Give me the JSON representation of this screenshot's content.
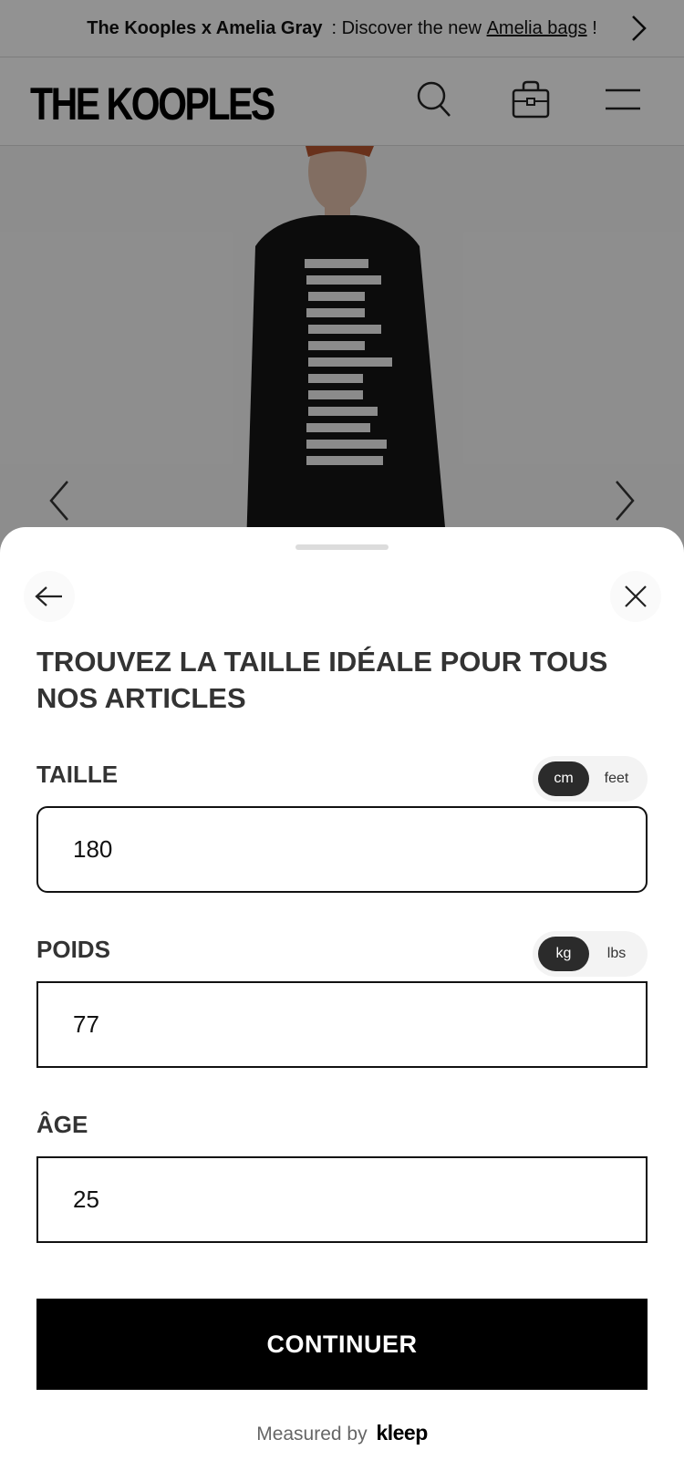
{
  "promo": {
    "collab": "The Kooples x Amelia Gray",
    "text_before": ": Discover the new",
    "link": "Amelia bags",
    "text_after": "!"
  },
  "header": {
    "logo": "THE KOOPLES",
    "icons": [
      "search-icon",
      "bag-icon",
      "menu-icon"
    ]
  },
  "sheet": {
    "title": "TROUVEZ LA TAILLE IDÉALE POUR TOUS NOS ARTICLES",
    "height": {
      "label": "TAILLE",
      "units": [
        "cm",
        "feet"
      ],
      "selected_unit": "cm",
      "value": "180"
    },
    "weight": {
      "label": "POIDS",
      "units": [
        "kg",
        "lbs"
      ],
      "selected_unit": "kg",
      "value": "77"
    },
    "age": {
      "label": "ÂGE",
      "value": "25"
    },
    "continue_label": "CONTINUER",
    "measured_by": "Measured by",
    "measured_brand": "kleep"
  },
  "colors": {
    "overlay": "#00000066",
    "primary_button": "#000000",
    "toggle_active": "#2b2b2b"
  }
}
